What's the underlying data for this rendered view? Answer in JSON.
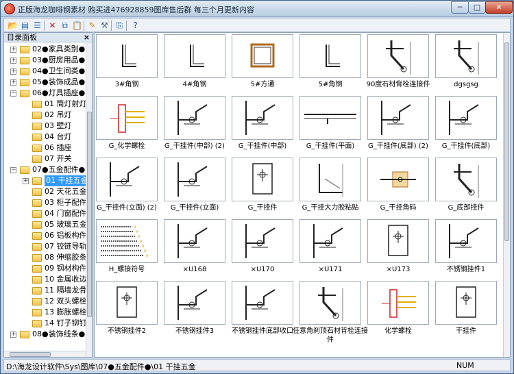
{
  "window": {
    "title": "正版海龙咖啡钢素材 购买进476928859图库售后群 每三个月更新内容",
    "minimize": "─",
    "maximize": "□",
    "close": "✕"
  },
  "toolbar": {
    "buttons": [
      {
        "name": "open-icon",
        "glyph": "📂",
        "color": "#c88a1a"
      },
      {
        "name": "browse-icon",
        "glyph": "▤",
        "color": "#2a6aa8"
      },
      {
        "name": "list-icon",
        "glyph": "☰",
        "color": "#2a6aa8"
      },
      {
        "name": "delete-icon",
        "glyph": "✕",
        "color": "#d0201a"
      },
      {
        "name": "copy-icon",
        "glyph": "⧉",
        "color": "#2a6aa8"
      },
      {
        "name": "paste-icon",
        "glyph": "📋",
        "color": "#8a6a2a"
      },
      {
        "name": "edit-icon",
        "glyph": "✎",
        "color": "#c88a1a"
      },
      {
        "name": "tool-icon",
        "glyph": "⚒",
        "color": "#4a6a8a"
      },
      {
        "name": "export-icon",
        "glyph": "⎘",
        "color": "#2a6aa8"
      },
      {
        "name": "help-icon",
        "glyph": "?",
        "color": "#1a4a9a"
      }
    ]
  },
  "tree_panel": {
    "title": "目录面板",
    "close": "×",
    "items": [
      {
        "label": "02●家具类别●",
        "level": 1,
        "expander": "+"
      },
      {
        "label": "03●厨房用品●",
        "level": 1,
        "expander": "+"
      },
      {
        "label": "04●卫生间类●",
        "level": 1,
        "expander": "+"
      },
      {
        "label": "05●装饰成品●",
        "level": 1,
        "expander": "+"
      },
      {
        "label": "06●灯具插座●",
        "level": 1,
        "expander": "−"
      },
      {
        "label": "01 筒灯射灯",
        "level": 2,
        "expander": ""
      },
      {
        "label": "02 吊灯",
        "level": 2,
        "expander": ""
      },
      {
        "label": "03 壁灯",
        "level": 2,
        "expander": ""
      },
      {
        "label": "04 台灯",
        "level": 2,
        "expander": ""
      },
      {
        "label": "06 插座",
        "level": 2,
        "expander": ""
      },
      {
        "label": "07 开关",
        "level": 2,
        "expander": ""
      },
      {
        "label": "07●五金配件●",
        "level": 1,
        "expander": "−"
      },
      {
        "label": "01 干挂五金",
        "level": 2,
        "expander": "+",
        "selected": true
      },
      {
        "label": "02 天花五金",
        "level": 2,
        "expander": ""
      },
      {
        "label": "03 柜子配件",
        "level": 2,
        "expander": ""
      },
      {
        "label": "04 门窗配件",
        "level": 2,
        "expander": ""
      },
      {
        "label": "05 玻璃五金",
        "level": 2,
        "expander": ""
      },
      {
        "label": "06 铝板构件",
        "level": 2,
        "expander": ""
      },
      {
        "label": "07 铰链导轨",
        "level": 2,
        "expander": ""
      },
      {
        "label": "08 伸缩胶条",
        "level": 2,
        "expander": ""
      },
      {
        "label": "09 钢材构件",
        "level": 2,
        "expander": ""
      },
      {
        "label": "10 金属收边",
        "level": 2,
        "expander": ""
      },
      {
        "label": "11 隔墙龙骨",
        "level": 2,
        "expander": ""
      },
      {
        "label": "12 双头螺栓",
        "level": 2,
        "expander": ""
      },
      {
        "label": "13 膨胀螺栓",
        "level": 2,
        "expander": ""
      },
      {
        "label": "14 钉子铆钉",
        "level": 2,
        "expander": ""
      },
      {
        "label": "08●装饰线条●",
        "level": 1,
        "expander": "+"
      }
    ]
  },
  "gallery": {
    "items": [
      {
        "label": "3#角钢",
        "icon": "angle-steel-icon"
      },
      {
        "label": "4#角钢",
        "icon": "angle-steel-icon"
      },
      {
        "label": "5#方通",
        "icon": "square-tube-icon"
      },
      {
        "label": "5#角钢",
        "icon": "angle-steel-icon"
      },
      {
        "label": "90度石材背栓连接件",
        "icon": "bracket-icon"
      },
      {
        "label": "dgsgsg",
        "icon": "bracket-icon"
      },
      {
        "label": "G_化学螺栓",
        "icon": "chemical-bolt-icon"
      },
      {
        "label": "G_干挂件(中部) (2)",
        "icon": "hanger-icon"
      },
      {
        "label": "G_干挂件(中部)",
        "icon": "hanger-icon"
      },
      {
        "label": "G_干挂件(平面)",
        "icon": "flat-hanger-icon"
      },
      {
        "label": "G_干挂件(底部) (2)",
        "icon": "hanger-icon"
      },
      {
        "label": "G_干挂件(底部)",
        "icon": "hanger-icon"
      },
      {
        "label": "G_干挂件(立面) (2)",
        "icon": "hanger-icon"
      },
      {
        "label": "G_干挂件(立面)",
        "icon": "hanger-icon"
      },
      {
        "label": "G_干挂件",
        "icon": "plate-icon"
      },
      {
        "label": "G_干挂大力胶粘贴",
        "icon": "adhesive-icon"
      },
      {
        "label": "G_干挂角码",
        "icon": "anchor-icon"
      },
      {
        "label": "G_底部挂件",
        "icon": "bracket-icon"
      },
      {
        "label": "H_螺接符号",
        "icon": "bolt-symbol-icon"
      },
      {
        "label": "×U168",
        "icon": "hanger-icon"
      },
      {
        "label": "×U170",
        "icon": "hanger-icon"
      },
      {
        "label": "×U171",
        "icon": "hanger-icon"
      },
      {
        "label": "×U173",
        "icon": "plate-icon"
      },
      {
        "label": "不锈钢挂件1",
        "icon": "hanger-icon"
      },
      {
        "label": "不锈钢挂件2",
        "icon": "plate-icon"
      },
      {
        "label": "不锈钢挂件3",
        "icon": "hanger-icon"
      },
      {
        "label": "不锈钢挂件底部收口",
        "icon": "hanger-icon"
      },
      {
        "label": "任意角刹顶石材背栓连接件",
        "icon": "bracket-icon"
      },
      {
        "label": "化学螺栓",
        "icon": "chemical-bolt-icon"
      },
      {
        "label": "干挂件",
        "icon": "plate-icon"
      }
    ]
  },
  "statusbar": {
    "path": "D:\\海龙设计软件\\Sys\\图库\\07●五金配件●\\01 干挂五金",
    "num": "NUM"
  }
}
